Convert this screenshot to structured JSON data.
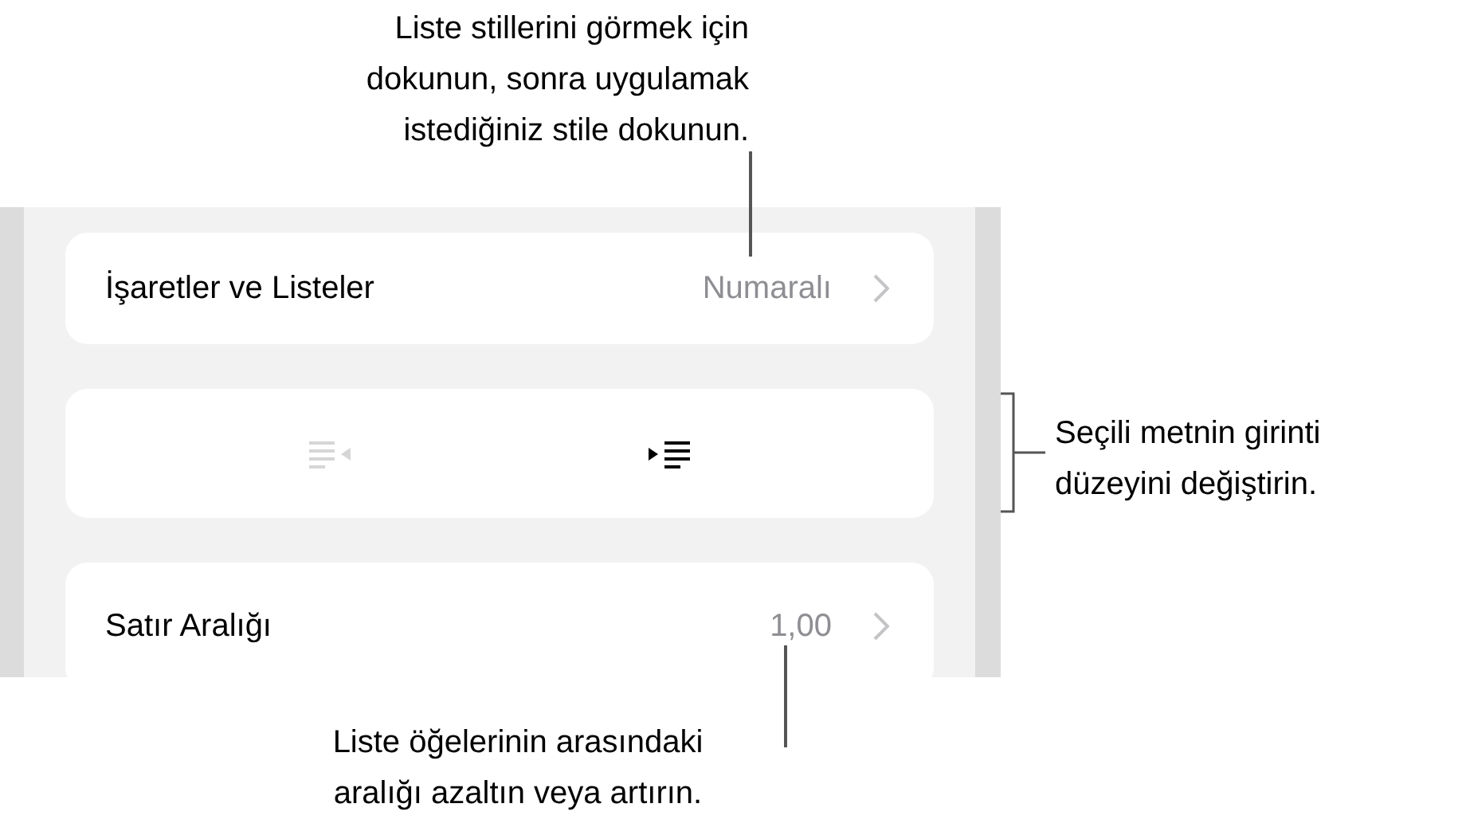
{
  "rows": [
    {
      "kind": "link",
      "label": "İşaretler ve Listeler",
      "value": "Numaralı"
    },
    {
      "kind": "indent",
      "buttons": [
        {
          "kind": "decrease",
          "disabled": true
        },
        {
          "kind": "increase",
          "disabled": false
        }
      ]
    },
    {
      "kind": "link",
      "label": "Satır Aralığı",
      "value": "1,00"
    }
  ],
  "callouts": [
    {
      "kind": "top",
      "lines": [
        "Liste stillerini görmek için",
        "dokunun, sonra uygulamak",
        "istediğiniz stile dokunun."
      ]
    },
    {
      "kind": "right",
      "lines": [
        "Seçili metnin girinti",
        "düzeyini değiştirin."
      ]
    },
    {
      "kind": "bottom",
      "lines": [
        "Liste öğelerinin arasındaki",
        "aralığı azaltın veya artırın."
      ]
    }
  ]
}
